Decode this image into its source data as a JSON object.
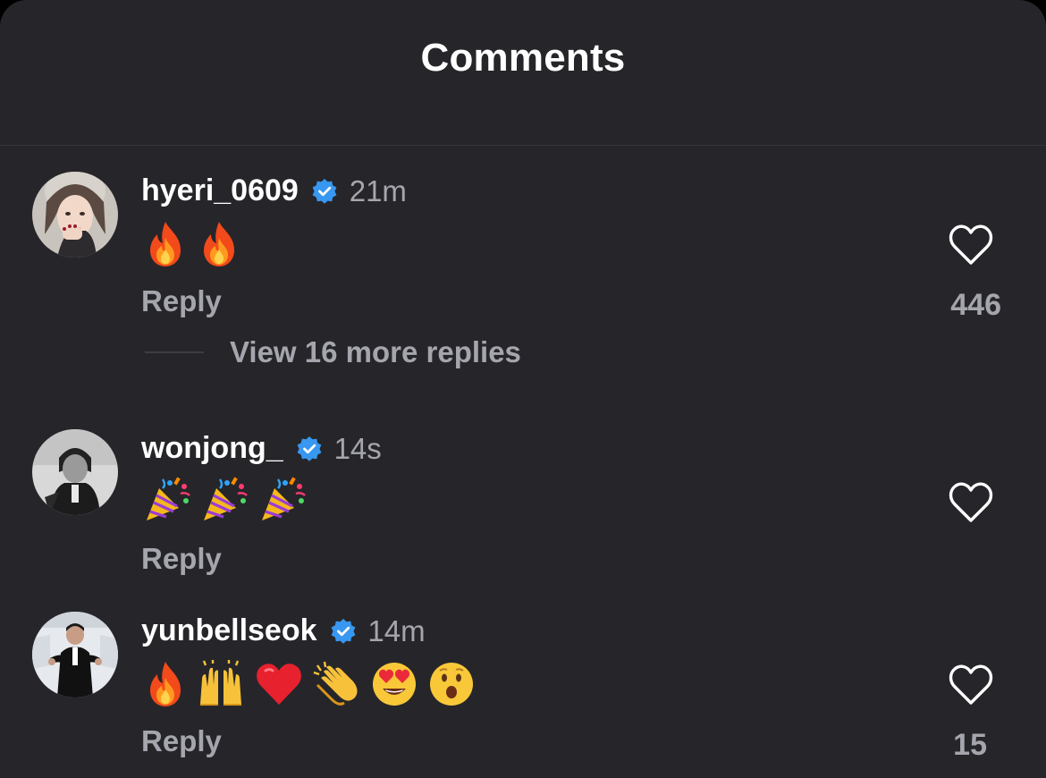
{
  "header": {
    "title": "Comments"
  },
  "comments": [
    {
      "username": "hyeri_0609",
      "verified": true,
      "time": "21m",
      "emojis": [
        "fire-emoji",
        "fire-emoji"
      ],
      "reply_label": "Reply",
      "like_count": "446",
      "view_replies": "View 16 more replies"
    },
    {
      "username": "wonjong_",
      "verified": true,
      "time": "14s",
      "emojis": [
        "party-popper-emoji",
        "party-popper-emoji",
        "party-popper-emoji"
      ],
      "reply_label": "Reply",
      "like_count": ""
    },
    {
      "username": "yunbellseok",
      "verified": true,
      "time": "14m",
      "emojis": [
        "fire-emoji",
        "raising-hands-emoji",
        "red-heart-emoji",
        "clapping-hands-emoji",
        "heart-eyes-emoji",
        "surprised-face-emoji"
      ],
      "reply_label": "Reply",
      "like_count": "15"
    }
  ],
  "colors": {
    "background": "#26262a",
    "primary_text": "#ffffff",
    "secondary_text": "#a5a6ad",
    "verified_badge": "#3897f0",
    "divider": "#34343a"
  },
  "icons": {
    "like": "heart-outline-icon",
    "verified": "verified-badge-icon"
  }
}
